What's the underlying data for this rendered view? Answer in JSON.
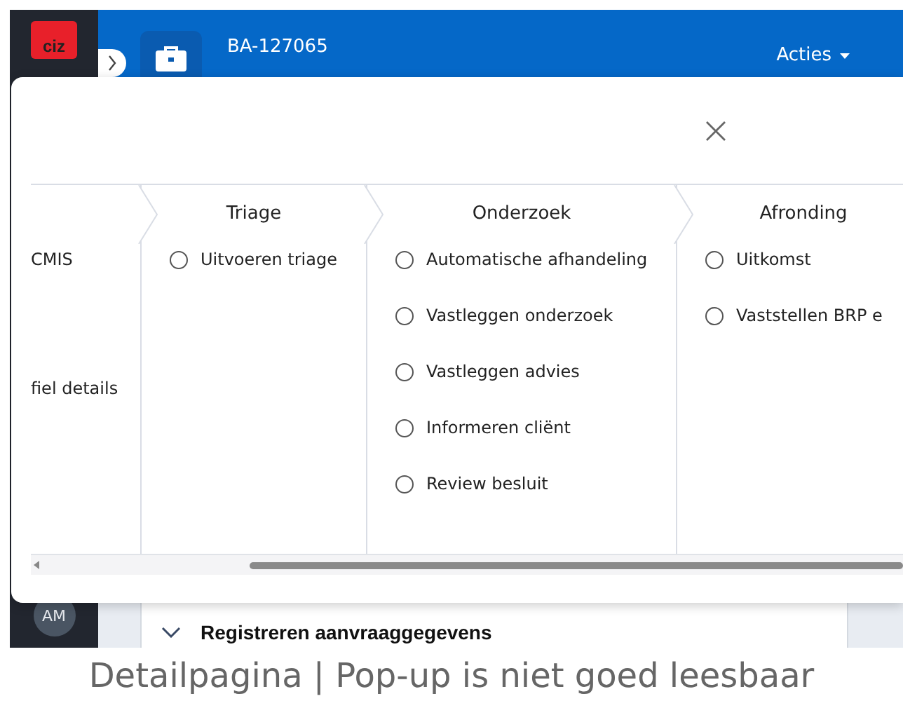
{
  "app": {
    "logo": "ciz",
    "case_number": "BA-127065",
    "actions_menu": "Acties",
    "avatar": "AM",
    "section": {
      "title": "Registreren aanvraaggegevens",
      "expanded": true
    }
  },
  "popup": {
    "stages": [
      {
        "kind": "partial",
        "items": [
          {
            "label": "CMIS"
          },
          {
            "label": "fiel details"
          }
        ]
      },
      {
        "kind": "stage",
        "title": "Triage",
        "items": [
          {
            "label": "Uitvoeren triage",
            "checked": false
          }
        ]
      },
      {
        "kind": "stage",
        "title": "Onderzoek",
        "items": [
          {
            "label": "Automatische afhandeling",
            "checked": false
          },
          {
            "label": "Vastleggen onderzoek",
            "checked": false
          },
          {
            "label": "Vastleggen advies",
            "checked": false
          },
          {
            "label": "Informeren cliënt",
            "checked": false
          },
          {
            "label": "Review besluit",
            "checked": false
          }
        ]
      },
      {
        "kind": "stage",
        "title": "Afronding",
        "items": [
          {
            "label": "Uitkomst",
            "checked": false
          },
          {
            "label": "Vaststellen BRP e",
            "checked": false
          }
        ]
      }
    ]
  },
  "caption": "Detailpagina | Pop-up is niet goed leesbaar"
}
